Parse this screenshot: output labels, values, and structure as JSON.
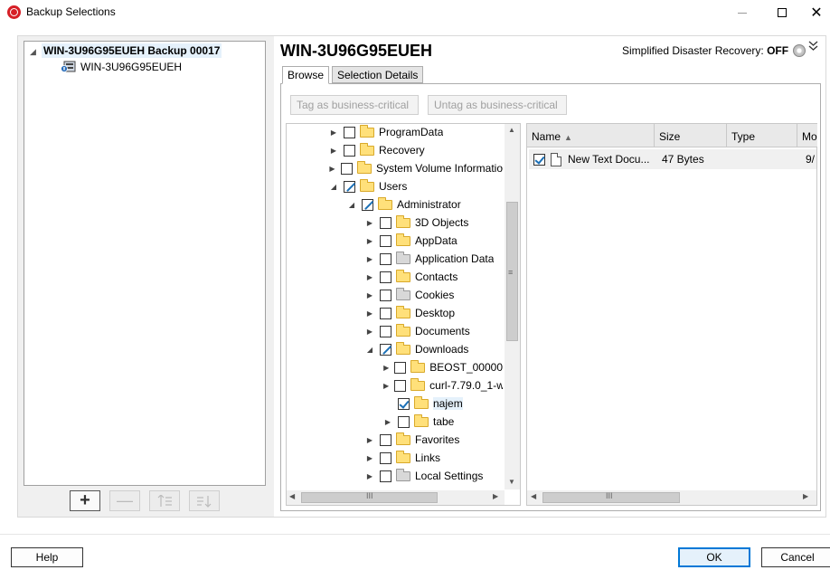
{
  "window": {
    "title": "Backup Selections",
    "minimize_icon": "minimize-icon",
    "maximize_icon": "maximize-icon",
    "close_glyph": "✕"
  },
  "left_tree": {
    "root_label": "WIN-3U96G95EUEH Backup 00017",
    "child_label": "WIN-3U96G95EUEH",
    "add_glyph": "+",
    "remove_glyph": "—"
  },
  "header": {
    "server_title": "WIN-3U96G95EUEH",
    "sdr_label": "Simplified Disaster Recovery:",
    "sdr_value": "OFF"
  },
  "tabs": [
    {
      "label": "Browse",
      "active": true
    },
    {
      "label": "Selection Details",
      "active": false
    }
  ],
  "toolbar": {
    "tag_label": "Tag as business-critical",
    "untag_label": "Untag as business-critical"
  },
  "folder_tree": [
    {
      "label": "ProgramData",
      "level": 0,
      "expander": "collapsed",
      "check": "none",
      "icon": "folder"
    },
    {
      "label": "Recovery",
      "level": 0,
      "expander": "collapsed",
      "check": "none",
      "icon": "folder"
    },
    {
      "label": "System Volume Informatio",
      "level": 0,
      "expander": "collapsed",
      "check": "none",
      "icon": "folder"
    },
    {
      "label": "Users",
      "level": 0,
      "expander": "expanded",
      "check": "partial",
      "icon": "folder"
    },
    {
      "label": "Administrator",
      "level": 1,
      "expander": "expanded",
      "check": "partial",
      "icon": "folder"
    },
    {
      "label": "3D Objects",
      "level": 2,
      "expander": "collapsed",
      "check": "none",
      "icon": "folder"
    },
    {
      "label": "AppData",
      "level": 2,
      "expander": "collapsed",
      "check": "none",
      "icon": "folder"
    },
    {
      "label": "Application Data",
      "level": 2,
      "expander": "collapsed",
      "check": "none",
      "icon": "folder-special"
    },
    {
      "label": "Contacts",
      "level": 2,
      "expander": "collapsed",
      "check": "none",
      "icon": "folder"
    },
    {
      "label": "Cookies",
      "level": 2,
      "expander": "collapsed",
      "check": "none",
      "icon": "folder-special"
    },
    {
      "label": "Desktop",
      "level": 2,
      "expander": "collapsed",
      "check": "none",
      "icon": "folder"
    },
    {
      "label": "Documents",
      "level": 2,
      "expander": "collapsed",
      "check": "none",
      "icon": "folder"
    },
    {
      "label": "Downloads",
      "level": 2,
      "expander": "expanded",
      "check": "partial",
      "icon": "folder"
    },
    {
      "label": "BEOST_00000",
      "level": 3,
      "expander": "collapsed",
      "check": "none",
      "icon": "folder"
    },
    {
      "label": "curl-7.79.0_1-w",
      "level": 3,
      "expander": "collapsed",
      "check": "none",
      "icon": "folder"
    },
    {
      "label": "najem",
      "level": 3,
      "expander": "none",
      "check": "checked",
      "icon": "folder",
      "selected": true
    },
    {
      "label": "tabe",
      "level": 3,
      "expander": "collapsed",
      "check": "none",
      "icon": "folder"
    },
    {
      "label": "Favorites",
      "level": 2,
      "expander": "collapsed",
      "check": "none",
      "icon": "folder"
    },
    {
      "label": "Links",
      "level": 2,
      "expander": "collapsed",
      "check": "none",
      "icon": "folder"
    },
    {
      "label": "Local Settings",
      "level": 2,
      "expander": "collapsed",
      "check": "none",
      "icon": "folder-special"
    }
  ],
  "file_list": {
    "columns": [
      "Name",
      "Size",
      "Type",
      "Mo"
    ],
    "sort_glyph": "▲",
    "rows": [
      {
        "name": "New Text Docu...",
        "size": "47 Bytes",
        "type": "",
        "modified": "9/",
        "checked": true
      }
    ]
  },
  "scroll": {
    "grip_h": "III",
    "grip_v": "≡",
    "up": "▲",
    "down": "▼",
    "left": "◀",
    "right": "▶"
  },
  "footer": {
    "help_label": "Help",
    "ok_label": "OK",
    "cancel_label": "Cancel"
  },
  "colors": {
    "app_icon": "#d61f26",
    "check_blue": "#1a6fb6",
    "selection": "#e5f1fb",
    "ok_border": "#0078d7"
  }
}
